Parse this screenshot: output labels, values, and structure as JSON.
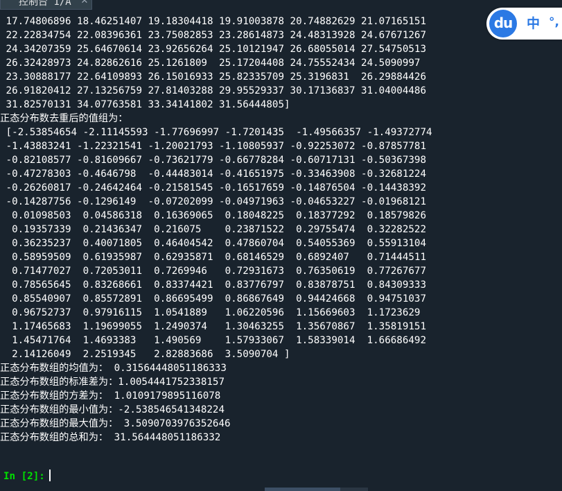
{
  "tab": {
    "label": "控制台 1/A",
    "close_symbol": "✕"
  },
  "console": {
    "lines": [
      " 17.74806896 18.46251407 19.18304418 19.91003878 20.74882629 21.07165151",
      " 22.22834754 22.08396361 23.75082853 23.28614873 24.48313928 24.67671267",
      " 24.34207359 25.64670614 23.92656264 25.10121947 26.68055014 27.54750513",
      " 26.32428973 24.82862616 25.1261809  25.17204408 24.75552434 24.5090997",
      " 23.30888177 22.64109893 26.15016933 25.82335709 25.3196831  26.29884426",
      " 26.91820412 27.13256759 27.81403288 29.95529337 30.17136837 31.04004486",
      " 31.82570131 34.07763581 33.34141802 31.56444805]",
      "正态分布数去重后的值组为：",
      " [-2.53854654 -2.11145593 -1.77696997 -1.7201435  -1.49566357 -1.49372774",
      " -1.43883241 -1.22321541 -1.20021793 -1.10805937 -0.92253072 -0.87857781",
      " -0.82108577 -0.81609667 -0.73621779 -0.66778284 -0.60717131 -0.50367398",
      " -0.47278303 -0.4646798  -0.44483014 -0.41651975 -0.33463908 -0.32681224",
      " -0.26260817 -0.24642464 -0.21581545 -0.16517659 -0.14876504 -0.14438392",
      " -0.14287756 -0.1296149  -0.07202099 -0.04971963 -0.04653227 -0.01968121",
      "  0.01098503  0.04586318  0.16369065  0.18048225  0.18377292  0.18579826",
      "  0.19357339  0.21436347  0.216075    0.23871522  0.29755474  0.32282522",
      "  0.36235237  0.40071805  0.46404542  0.47860704  0.54055369  0.55913104",
      "  0.58959509  0.61935987  0.62935871  0.68146529  0.6892407   0.71444511",
      "  0.71477027  0.72053011  0.7269946   0.72931673  0.76350619  0.77267677",
      "  0.78565645  0.83268661  0.83374421  0.83776797  0.83878751  0.84309333",
      "  0.85540907  0.85572891  0.86695499  0.86867649  0.94424668  0.94751037",
      "  0.96752737  0.97916115  1.0541889   1.06220596  1.15669603  1.1723629",
      "  1.17465683  1.19699055  1.2490374   1.30463255  1.35670867  1.35819151",
      "  1.45471764  1.4693383   1.490569    1.57933067  1.58339014  1.66686492",
      "  2.14126049  2.2519345   2.82883686  3.5090704 ]",
      "正态分布数组的均值为： 0.31564448051186333",
      "正态分布数组的标准差为：1.0054441752338157",
      "正态分布数组的方差为： 1.0109179895116078",
      "正态分布数组的最小值为：-2.538546541348224",
      "正态分布数组的最大值为： 3.5090703976352646",
      "正态分布数组的总和为： 31.564448051186332"
    ]
  },
  "prompt": {
    "label": "In [2]:"
  },
  "ime": {
    "logo": "du",
    "language": "中",
    "punctuation": "°,"
  },
  "colors": {
    "background": "#19232d",
    "text": "#ffffff",
    "prompt": "#00e000",
    "ime_accent": "#2b79e4"
  }
}
